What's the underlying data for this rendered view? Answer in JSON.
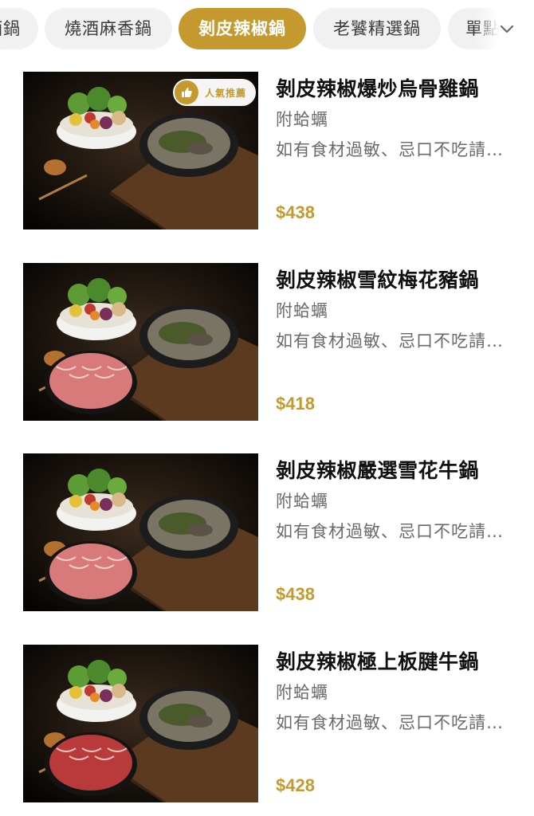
{
  "tabs": [
    {
      "label": "酒鍋",
      "active": false
    },
    {
      "label": "燒酒麻香鍋",
      "active": false
    },
    {
      "label": "剝皮辣椒鍋",
      "active": true
    },
    {
      "label": "老饕精選鍋",
      "active": false
    },
    {
      "label": "單點",
      "active": false
    }
  ],
  "tab_expand_icon": "chevron-down-icon",
  "badge": {
    "label": "人氣推薦",
    "icon": "thumbs-up-icon"
  },
  "items": [
    {
      "name": "剝皮辣椒爆炒烏骨雞鍋",
      "note": "附蛤蠣",
      "desc": "如有食材過敏、忌口不吃請務必告知",
      "price": "$438",
      "meat": "chicken",
      "popular": true
    },
    {
      "name": "剝皮辣椒雪紋梅花豬鍋",
      "note": "附蛤蠣",
      "desc": "如有食材過敏、忌口不吃請務必告知",
      "price": "$418",
      "meat": "pork",
      "popular": false
    },
    {
      "name": "剝皮辣椒嚴選雪花牛鍋",
      "note": "附蛤蠣",
      "desc": "如有食材過敏、忌口不吃請務必告知",
      "price": "$438",
      "meat": "beef-marbled",
      "popular": false
    },
    {
      "name": "剝皮辣椒極上板腱牛鍋",
      "note": "附蛤蠣",
      "desc": "如有食材過敏、忌口不吃請務必告知",
      "price": "$428",
      "meat": "beef-red",
      "popular": false
    }
  ],
  "colors": {
    "accent": "#c49a2e",
    "tab_bg": "#f1f1f1",
    "text_muted": "#6a6a6a"
  }
}
